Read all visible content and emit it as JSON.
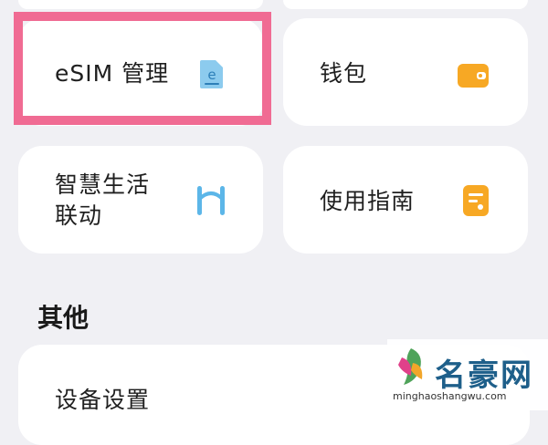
{
  "cards": {
    "esim": {
      "label": "eSIM 管理",
      "icon": "esim-card-icon",
      "icon_color": "#7fc4ea"
    },
    "wallet": {
      "label": "钱包",
      "icon": "wallet-icon",
      "icon_color": "#f7a824"
    },
    "smart_life_line1": "智慧生活",
    "smart_life_line2": "联动",
    "smart_life_icon": "smart-life-link-icon",
    "smart_life_icon_color": "#5cb6e8",
    "guide": {
      "label": "使用指南",
      "icon": "guide-icon",
      "icon_color": "#f7a824"
    },
    "device_settings": {
      "label": "设备设置"
    }
  },
  "sections": {
    "other_title": "其他"
  },
  "highlight_color": "#f06b93",
  "watermark": {
    "title": "名豪网",
    "url": "minghaoshangwu.com"
  }
}
